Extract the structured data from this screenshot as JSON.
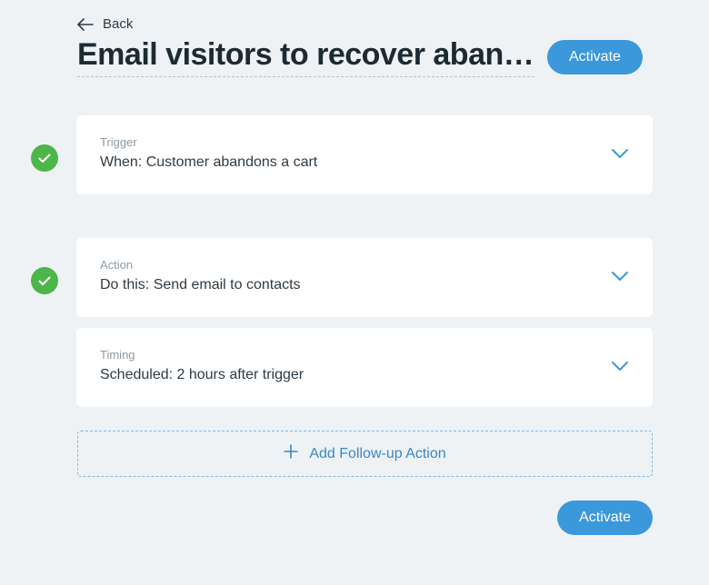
{
  "header": {
    "back_label": "Back",
    "title": "Email visitors to recover abandoned carts",
    "activate_label": "Activate"
  },
  "steps": {
    "trigger": {
      "label": "Trigger",
      "value": "When: Customer abandons a cart",
      "complete": true
    },
    "action": {
      "label": "Action",
      "value": "Do this: Send email to contacts",
      "complete": true
    },
    "timing": {
      "label": "Timing",
      "value": "Scheduled: 2 hours after trigger",
      "complete": false
    }
  },
  "add_followup_label": "Add Follow-up Action",
  "footer": {
    "activate_label": "Activate"
  },
  "colors": {
    "accent": "#3a98db",
    "success": "#4db64a",
    "bg": "#eef2f5"
  }
}
